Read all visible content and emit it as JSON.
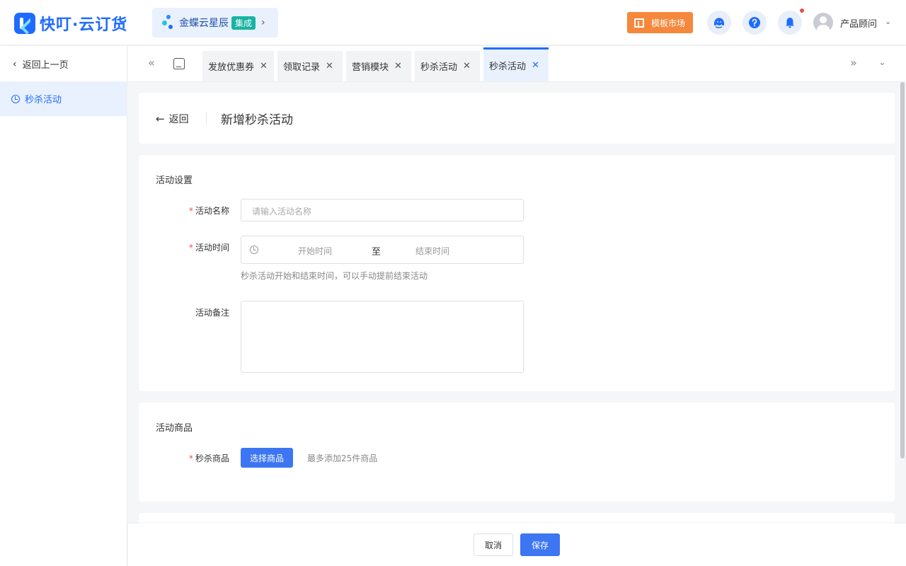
{
  "header": {
    "logo_text": "快叮·云订货",
    "kingdee": {
      "label": "金蝶云星辰",
      "badge": "集成"
    },
    "market_label": "模板市场",
    "user_name": "产品顾问",
    "colors": {
      "brand": "#1f6bff",
      "accent_orange": "#f5883c",
      "notice_dot": "#f24b4b"
    }
  },
  "sidebar": {
    "back_label": "返回上一页",
    "items": [
      {
        "label": "秒杀活动",
        "icon": "clock-icon",
        "active": true
      }
    ]
  },
  "tabs": [
    {
      "label": "发放优惠券"
    },
    {
      "label": "领取记录"
    },
    {
      "label": "营销模块"
    },
    {
      "label": "秒杀活动"
    },
    {
      "label": "秒杀活动",
      "active": true
    }
  ],
  "page": {
    "back_label": "返回",
    "title": "新增秒杀活动"
  },
  "settings": {
    "section_title": "活动设置",
    "name_label": "活动名称",
    "name_placeholder": "请输入活动名称",
    "time_label": "活动时间",
    "start_placeholder": "开始时间",
    "range_separator": "至",
    "end_placeholder": "结束时间",
    "time_hint": "秒杀活动开始和结束时间，可以手动提前结束活动",
    "remark_label": "活动备注"
  },
  "goods": {
    "section_title": "活动商品",
    "label": "秒杀商品",
    "select_button": "选择商品",
    "hint": "最多添加25件商品"
  },
  "footer": {
    "cancel_label": "取消",
    "save_label": "保存"
  }
}
